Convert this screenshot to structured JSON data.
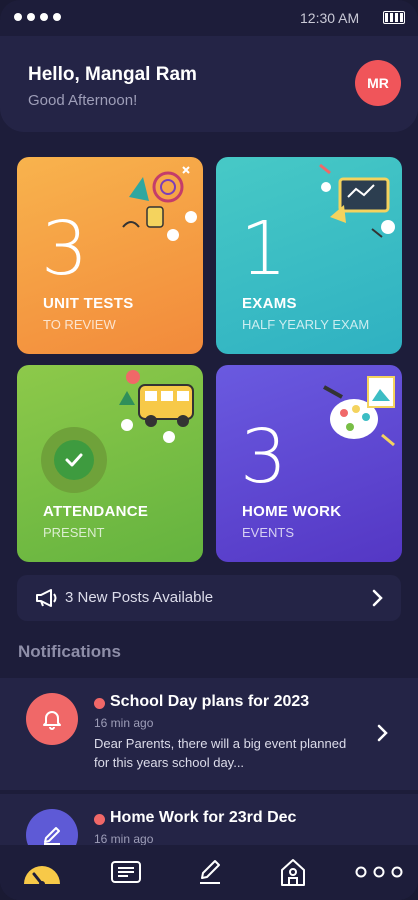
{
  "status_bar": {
    "time": "12:30 AM"
  },
  "header": {
    "greeting": "Hello, Mangal Ram",
    "sub_greeting": "Good Afternoon!",
    "avatar_initials": "MR"
  },
  "cards": [
    {
      "count": "3",
      "title": "UNIT TESTS",
      "subtitle": "TO REVIEW",
      "color": "#f59d44"
    },
    {
      "count": "1",
      "title": "EXAMS",
      "subtitle": "HALF YEARLY EXAM",
      "color": "#3cbdc4"
    },
    {
      "count": "",
      "title": "ATTENDANCE",
      "subtitle": "PRESENT",
      "color": "#78be45"
    },
    {
      "count": "3",
      "title": "HOME WORK",
      "subtitle": "EVENTS",
      "color": "#5f48d2"
    }
  ],
  "posts_banner": {
    "label": "3 New Posts Available"
  },
  "notifications_section": {
    "title": "Notifications"
  },
  "notifications": [
    {
      "title": "School Day plans for 2023",
      "time": "16 min ago",
      "body": "Dear Parents, there will a big event planned for this years school day...",
      "icon": "bell-icon",
      "icon_color": "#f06868"
    },
    {
      "title": "Home Work for 23rd Dec",
      "time": "16 min ago",
      "body": "",
      "icon": "pencil-icon",
      "icon_color": "#5e5ad6"
    }
  ],
  "bottom_nav": [
    {
      "icon": "dashboard-icon"
    },
    {
      "icon": "news-icon"
    },
    {
      "icon": "edit-icon"
    },
    {
      "icon": "school-icon"
    },
    {
      "icon": "more-icon"
    }
  ]
}
